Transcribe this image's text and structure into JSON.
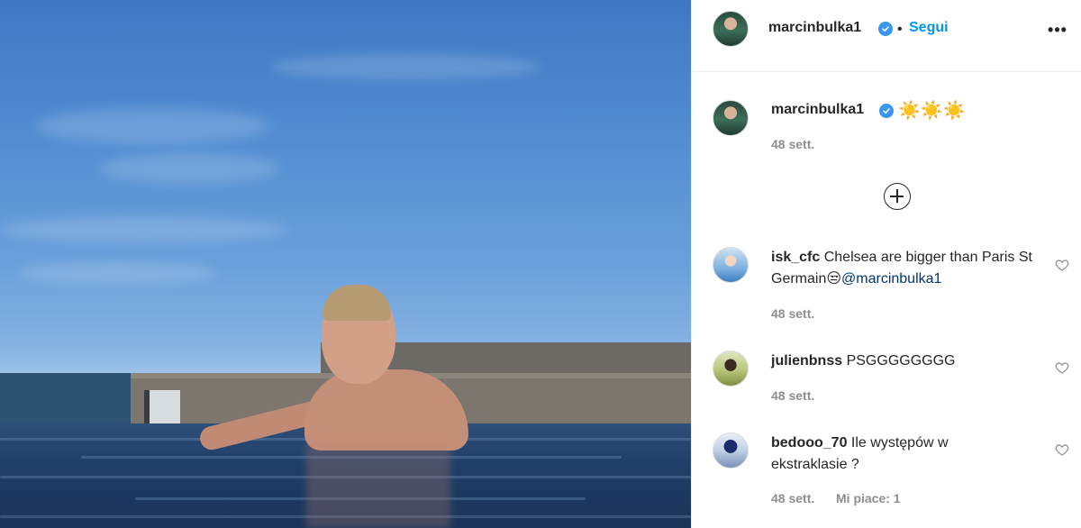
{
  "post": {
    "author": "marcinbulka1",
    "follow_label": "Segui",
    "dot": "•",
    "more_label": "•••",
    "caption_emoji": "☀️☀️☀️",
    "caption_time": "48 sett."
  },
  "comments": [
    {
      "username": "isk_cfc",
      "text": "Chelsea are bigger than Paris St Germain😒",
      "mention": "@marcinbulka1",
      "time": "48 sett.",
      "likes": ""
    },
    {
      "username": "julienbnss",
      "text": "PSGGGGGGGG",
      "mention": "",
      "time": "48 sett.",
      "likes": ""
    },
    {
      "username": "bedooo_70",
      "text": "Ile występów w ekstraklasie ?",
      "mention": "",
      "time": "48 sett.",
      "likes": "Mi piace: 1"
    }
  ],
  "colors": {
    "follow_blue": "#0095f6",
    "verified_blue": "#3897f0",
    "muted_text": "#8e8e8e",
    "mention_blue": "#00376b"
  },
  "icons": [
    "verified-badge-icon",
    "more-options-icon",
    "add-comment-plus-icon",
    "heart-like-icon"
  ]
}
